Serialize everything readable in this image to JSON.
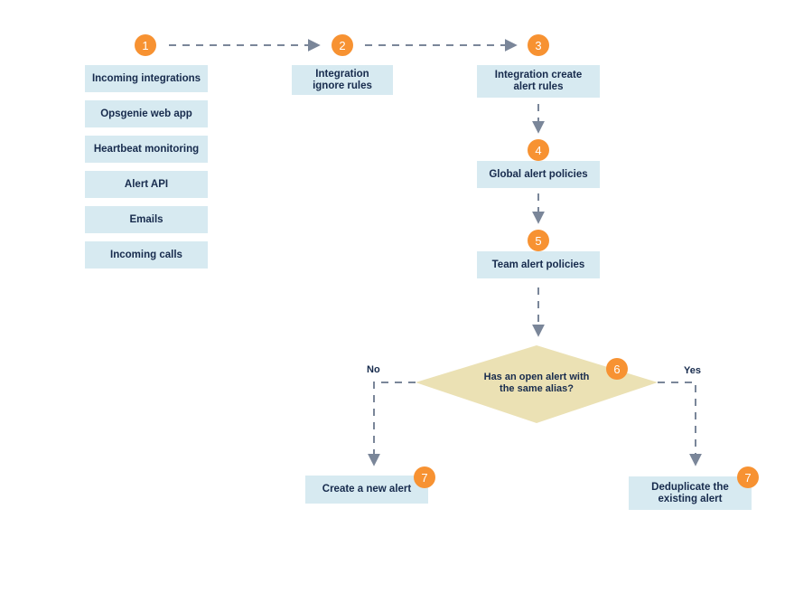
{
  "colors": {
    "box_fill": "#d7eaf1",
    "badge_fill": "#f79232",
    "diamond_fill": "#ebe1b4",
    "connector": "#7a8699",
    "text": "#172b4d"
  },
  "steps": {
    "s1": {
      "badge": "1",
      "sources": [
        "Incoming integrations",
        "Opsgenie web app",
        "Heartbeat monitoring",
        "Alert API",
        "Emails",
        "Incoming calls"
      ]
    },
    "s2": {
      "badge": "2",
      "label_line1": "Integration",
      "label_line2": "ignore rules"
    },
    "s3": {
      "badge": "3",
      "label_line1": "Integration create",
      "label_line2": "alert rules"
    },
    "s4": {
      "badge": "4",
      "label": "Global alert policies"
    },
    "s5": {
      "badge": "5",
      "label": "Team alert policies"
    },
    "s6": {
      "badge": "6",
      "question_line1": "Has an open alert with",
      "question_line2": "the same alias?",
      "no_label": "No",
      "yes_label": "Yes"
    },
    "s7_no": {
      "badge": "7",
      "label": "Create a new alert"
    },
    "s7_yes": {
      "badge": "7",
      "label_line1": "Deduplicate the",
      "label_line2": "existing alert"
    }
  }
}
